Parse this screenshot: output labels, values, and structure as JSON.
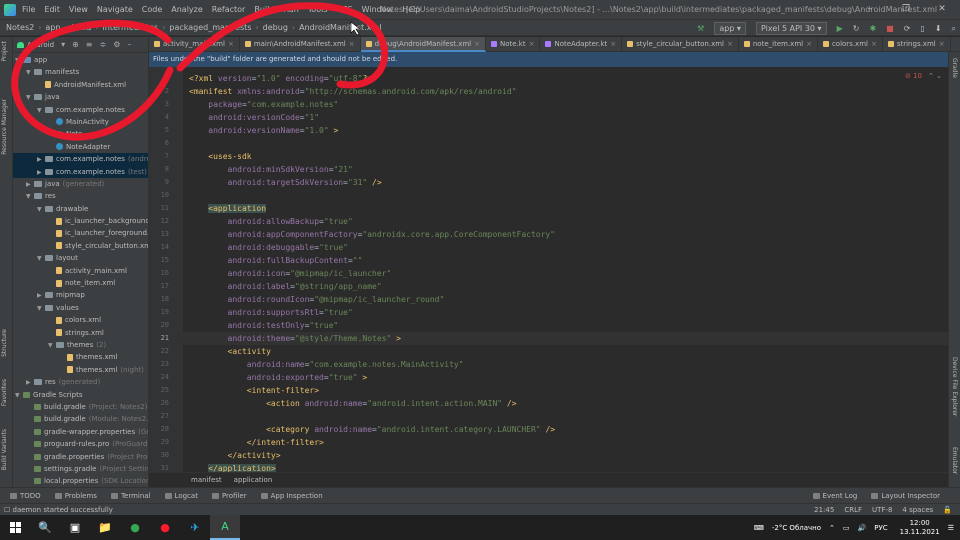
{
  "menubar": {
    "items": [
      "File",
      "Edit",
      "View",
      "Navigate",
      "Code",
      "Analyze",
      "Refactor",
      "Build",
      "Run",
      "Tools",
      "VCS",
      "Window",
      "Help"
    ],
    "window_title": "Notes [C:\\Users\\daima\\AndroidStudioProjects\\Notes2] - ...\\Notes2\\app\\build\\intermediates\\packaged_manifests\\debug\\AndroidManifest.xml",
    "controls": [
      "–",
      "❐",
      "✕"
    ]
  },
  "navbar": {
    "crumbs": [
      "Notes2",
      "app",
      "build",
      "intermediates",
      "packaged_manifests",
      "debug",
      "AndroidManifest.xml"
    ],
    "run_config": "app",
    "device": "Pixel 5 API 30"
  },
  "project_panel": {
    "title": "Android",
    "tree": [
      {
        "label": "app",
        "hint": "",
        "depth": 0,
        "arrow": "▼",
        "icon": "folder-blue"
      },
      {
        "label": "manifests",
        "hint": "",
        "depth": 1,
        "arrow": "▼",
        "icon": "folder"
      },
      {
        "label": "AndroidManifest.xml",
        "hint": "",
        "depth": 2,
        "arrow": "",
        "icon": "file-xml"
      },
      {
        "label": "java",
        "hint": "",
        "depth": 1,
        "arrow": "▼",
        "icon": "folder"
      },
      {
        "label": "com.example.notes",
        "hint": "",
        "depth": 2,
        "arrow": "▼",
        "icon": "folder"
      },
      {
        "label": "MainActivity",
        "hint": "",
        "depth": 3,
        "arrow": "",
        "icon": "file-c"
      },
      {
        "label": "Note",
        "hint": "",
        "depth": 3,
        "arrow": "",
        "icon": "file-c"
      },
      {
        "label": "NoteAdapter",
        "hint": "",
        "depth": 3,
        "arrow": "",
        "icon": "file-c"
      },
      {
        "label": "com.example.notes",
        "hint": "(androidTest)",
        "depth": 2,
        "arrow": "▶",
        "icon": "folder",
        "hl": true
      },
      {
        "label": "com.example.notes",
        "hint": "(test)",
        "depth": 2,
        "arrow": "▶",
        "icon": "folder",
        "hl": true
      },
      {
        "label": "java",
        "hint": "(generated)",
        "depth": 1,
        "arrow": "▶",
        "icon": "folder"
      },
      {
        "label": "res",
        "hint": "",
        "depth": 1,
        "arrow": "▼",
        "icon": "folder"
      },
      {
        "label": "drawable",
        "hint": "",
        "depth": 2,
        "arrow": "▼",
        "icon": "folder"
      },
      {
        "label": "ic_launcher_background.xml",
        "hint": "",
        "depth": 3,
        "arrow": "",
        "icon": "file-xml"
      },
      {
        "label": "ic_launcher_foreground.xml",
        "hint": "",
        "depth": 3,
        "arrow": "",
        "icon": "file-xml"
      },
      {
        "label": "style_circular_button.xml",
        "hint": "",
        "depth": 3,
        "arrow": "",
        "icon": "file-xml"
      },
      {
        "label": "layout",
        "hint": "",
        "depth": 2,
        "arrow": "▼",
        "icon": "folder"
      },
      {
        "label": "activity_main.xml",
        "hint": "",
        "depth": 3,
        "arrow": "",
        "icon": "file-xml"
      },
      {
        "label": "note_item.xml",
        "hint": "",
        "depth": 3,
        "arrow": "",
        "icon": "file-xml"
      },
      {
        "label": "mipmap",
        "hint": "",
        "depth": 2,
        "arrow": "▶",
        "icon": "folder"
      },
      {
        "label": "values",
        "hint": "",
        "depth": 2,
        "arrow": "▼",
        "icon": "folder"
      },
      {
        "label": "colors.xml",
        "hint": "",
        "depth": 3,
        "arrow": "",
        "icon": "file-xml"
      },
      {
        "label": "strings.xml",
        "hint": "",
        "depth": 3,
        "arrow": "",
        "icon": "file-xml"
      },
      {
        "label": "themes",
        "hint": "(2)",
        "depth": 3,
        "arrow": "▼",
        "icon": "folder"
      },
      {
        "label": "themes.xml",
        "hint": "",
        "depth": 4,
        "arrow": "",
        "icon": "file-xml"
      },
      {
        "label": "themes.xml",
        "hint": "(night)",
        "depth": 4,
        "arrow": "",
        "icon": "file-xml"
      },
      {
        "label": "res",
        "hint": "(generated)",
        "depth": 1,
        "arrow": "▶",
        "icon": "folder"
      },
      {
        "label": "Gradle Scripts",
        "hint": "",
        "depth": 0,
        "arrow": "▼",
        "icon": "file-gradle"
      },
      {
        "label": "build.gradle",
        "hint": "(Project: Notes2)",
        "depth": 1,
        "arrow": "",
        "icon": "file-gradle"
      },
      {
        "label": "build.gradle",
        "hint": "(Module: Notes2.app)",
        "depth": 1,
        "arrow": "",
        "icon": "file-gradle"
      },
      {
        "label": "gradle-wrapper.properties",
        "hint": "(Gradle Version)",
        "depth": 1,
        "arrow": "",
        "icon": "file-gradle"
      },
      {
        "label": "proguard-rules.pro",
        "hint": "(ProGuard Rules)",
        "depth": 1,
        "arrow": "",
        "icon": "file-gradle"
      },
      {
        "label": "gradle.properties",
        "hint": "(Project Properties)",
        "depth": 1,
        "arrow": "",
        "icon": "file-gradle"
      },
      {
        "label": "settings.gradle",
        "hint": "(Project Settings)",
        "depth": 1,
        "arrow": "",
        "icon": "file-gradle"
      },
      {
        "label": "local.properties",
        "hint": "(SDK Location)",
        "depth": 1,
        "arrow": "",
        "icon": "file-gradle"
      }
    ]
  },
  "left_strip": [
    "Project",
    "Resource Manager",
    "Structure",
    "Favorites",
    "Build Variants"
  ],
  "right_strip": [
    "Gradle",
    "Device File Explorer",
    "Emulator"
  ],
  "tabs": [
    {
      "label": "activity_main.xml",
      "active": false
    },
    {
      "label": "main\\AndroidManifest.xml",
      "active": false
    },
    {
      "label": "debug\\AndroidManifest.xml",
      "active": true
    },
    {
      "label": "Note.kt",
      "active": false
    },
    {
      "label": "NoteAdapter.kt",
      "active": false
    },
    {
      "label": "style_circular_button.xml",
      "active": false
    },
    {
      "label": "note_item.xml",
      "active": false
    },
    {
      "label": "colors.xml",
      "active": false
    },
    {
      "label": "strings.xml",
      "active": false
    }
  ],
  "banner": "Files under the \"build\" folder are generated and should not be edited.",
  "editor": {
    "error_count": "10",
    "current_line": 21,
    "lines": [
      {
        "n": "1",
        "indent": "",
        "parts": [
          [
            "decl",
            "<?xml "
          ],
          [
            "attr",
            "version"
          ],
          [
            "txt",
            "="
          ],
          [
            "str",
            "\"1.0\" "
          ],
          [
            "attr",
            "encoding"
          ],
          [
            "txt",
            "="
          ],
          [
            "str",
            "\"utf-8\""
          ],
          [
            "decl",
            "?>"
          ]
        ]
      },
      {
        "n": "2",
        "indent": "",
        "parts": [
          [
            "tag",
            "<manifest "
          ],
          [
            "ns",
            "xmlns:"
          ],
          [
            "attr",
            "android"
          ],
          [
            "txt",
            "="
          ],
          [
            "str",
            "\"http://schemas.android.com/apk/res/android\""
          ]
        ]
      },
      {
        "n": "3",
        "indent": "    ",
        "parts": [
          [
            "attr",
            "package"
          ],
          [
            "txt",
            "="
          ],
          [
            "str",
            "\"com.example.notes\""
          ]
        ]
      },
      {
        "n": "4",
        "indent": "    ",
        "parts": [
          [
            "ns",
            "android:"
          ],
          [
            "attr",
            "versionCode"
          ],
          [
            "txt",
            "="
          ],
          [
            "str",
            "\"1\""
          ]
        ]
      },
      {
        "n": "5",
        "indent": "    ",
        "parts": [
          [
            "ns",
            "android:"
          ],
          [
            "attr",
            "versionName"
          ],
          [
            "txt",
            "="
          ],
          [
            "str",
            "\"1.0\" "
          ],
          [
            "tag",
            ">"
          ]
        ]
      },
      {
        "n": "6",
        "indent": "",
        "parts": []
      },
      {
        "n": "7",
        "indent": "    ",
        "parts": [
          [
            "tag",
            "<uses-sdk"
          ]
        ]
      },
      {
        "n": "8",
        "indent": "        ",
        "parts": [
          [
            "ns",
            "android:"
          ],
          [
            "attr",
            "minSdkVersion"
          ],
          [
            "txt",
            "="
          ],
          [
            "str",
            "\"21\""
          ]
        ]
      },
      {
        "n": "9",
        "indent": "        ",
        "parts": [
          [
            "ns",
            "android:"
          ],
          [
            "attr",
            "targetSdkVersion"
          ],
          [
            "txt",
            "="
          ],
          [
            "str",
            "\"31\" "
          ],
          [
            "tag",
            "/>"
          ]
        ]
      },
      {
        "n": "10",
        "indent": "",
        "parts": []
      },
      {
        "n": "11",
        "indent": "    ",
        "parts": [
          [
            "tag",
            "<application"
          ]
        ]
      },
      {
        "n": "12",
        "indent": "        ",
        "parts": [
          [
            "ns",
            "android:"
          ],
          [
            "attr",
            "allowBackup"
          ],
          [
            "txt",
            "="
          ],
          [
            "str",
            "\"true\""
          ]
        ]
      },
      {
        "n": "13",
        "indent": "        ",
        "parts": [
          [
            "ns",
            "android:"
          ],
          [
            "attr",
            "appComponentFactory"
          ],
          [
            "txt",
            "="
          ],
          [
            "str",
            "\"androidx.core.app.CoreComponentFactory\""
          ]
        ]
      },
      {
        "n": "14",
        "indent": "        ",
        "parts": [
          [
            "ns",
            "android:"
          ],
          [
            "attr",
            "debuggable"
          ],
          [
            "txt",
            "="
          ],
          [
            "str",
            "\"true\""
          ]
        ]
      },
      {
        "n": "15",
        "indent": "        ",
        "parts": [
          [
            "ns",
            "android:"
          ],
          [
            "attr",
            "fullBackupContent"
          ],
          [
            "txt",
            "="
          ],
          [
            "str",
            "\"\""
          ]
        ]
      },
      {
        "n": "16",
        "indent": "        ",
        "parts": [
          [
            "ns",
            "android:"
          ],
          [
            "attr",
            "icon"
          ],
          [
            "txt",
            "="
          ],
          [
            "str",
            "\"@mipmap/ic_launcher\""
          ]
        ]
      },
      {
        "n": "17",
        "indent": "        ",
        "parts": [
          [
            "ns",
            "android:"
          ],
          [
            "attr",
            "label"
          ],
          [
            "txt",
            "="
          ],
          [
            "str",
            "\"@string/app_name\""
          ]
        ]
      },
      {
        "n": "18",
        "indent": "        ",
        "parts": [
          [
            "ns",
            "android:"
          ],
          [
            "attr",
            "roundIcon"
          ],
          [
            "txt",
            "="
          ],
          [
            "str",
            "\"@mipmap/ic_launcher_round\""
          ]
        ]
      },
      {
        "n": "19",
        "indent": "        ",
        "parts": [
          [
            "ns",
            "android:"
          ],
          [
            "attr",
            "supportsRtl"
          ],
          [
            "txt",
            "="
          ],
          [
            "str",
            "\"true\""
          ]
        ]
      },
      {
        "n": "20",
        "indent": "        ",
        "parts": [
          [
            "ns",
            "android:"
          ],
          [
            "attr",
            "testOnly"
          ],
          [
            "txt",
            "="
          ],
          [
            "str",
            "\"true\""
          ]
        ]
      },
      {
        "n": "21",
        "indent": "        ",
        "parts": [
          [
            "ns",
            "android:"
          ],
          [
            "attr",
            "theme"
          ],
          [
            "txt",
            "="
          ],
          [
            "str",
            "\"@style/Theme.Notes\" "
          ],
          [
            "tag",
            ">"
          ]
        ]
      },
      {
        "n": "22",
        "indent": "        ",
        "parts": [
          [
            "tag",
            "<activity"
          ]
        ]
      },
      {
        "n": "23",
        "indent": "            ",
        "parts": [
          [
            "ns",
            "android:"
          ],
          [
            "attr",
            "name"
          ],
          [
            "txt",
            "="
          ],
          [
            "str",
            "\"com.example.notes.MainActivity\""
          ]
        ]
      },
      {
        "n": "24",
        "indent": "            ",
        "parts": [
          [
            "ns",
            "android:"
          ],
          [
            "attr",
            "exported"
          ],
          [
            "txt",
            "="
          ],
          [
            "str",
            "\"true\" "
          ],
          [
            "tag",
            ">"
          ]
        ]
      },
      {
        "n": "25",
        "indent": "            ",
        "parts": [
          [
            "tag",
            "<intent-filter>"
          ]
        ]
      },
      {
        "n": "26",
        "indent": "                ",
        "parts": [
          [
            "tag",
            "<action "
          ],
          [
            "ns",
            "android:"
          ],
          [
            "attr",
            "name"
          ],
          [
            "txt",
            "="
          ],
          [
            "str",
            "\"android.intent.action.MAIN\" "
          ],
          [
            "tag",
            "/>"
          ]
        ]
      },
      {
        "n": "27",
        "indent": "",
        "parts": []
      },
      {
        "n": "28",
        "indent": "                ",
        "parts": [
          [
            "tag",
            "<category "
          ],
          [
            "ns",
            "android:"
          ],
          [
            "attr",
            "name"
          ],
          [
            "txt",
            "="
          ],
          [
            "str",
            "\"android.intent.category.LAUNCHER\" "
          ],
          [
            "tag",
            "/>"
          ]
        ]
      },
      {
        "n": "29",
        "indent": "            ",
        "parts": [
          [
            "tag",
            "</intent-filter>"
          ]
        ]
      },
      {
        "n": "30",
        "indent": "        ",
        "parts": [
          [
            "tag",
            "</activity>"
          ]
        ]
      },
      {
        "n": "31",
        "indent": "    ",
        "parts": [
          [
            "tag",
            "</application>"
          ]
        ]
      }
    ]
  },
  "editor_breadcrumb": [
    "manifest",
    "application"
  ],
  "bottom_tools": [
    "TODO",
    "Problems",
    "Terminal",
    "Logcat",
    "Profiler",
    "App Inspection"
  ],
  "bottom_tools_right": [
    "Event Log",
    "Layout Inspector"
  ],
  "status": {
    "message": "daemon started successfully",
    "position": "21:45",
    "line_sep": "CRLF",
    "encoding": "UTF-8",
    "indent": "4 spaces"
  },
  "taskbar": {
    "apps": [
      "🔍",
      "▣",
      "📁",
      "●",
      "●",
      "✈",
      "A"
    ],
    "weather": "-2°C  Облачно",
    "lang": "РУС",
    "time": "12:00",
    "date": "13.11.2021"
  },
  "colors": {
    "annotation": "#e8192c",
    "accent": "#4a88c7",
    "banner": "#2e4c6c"
  }
}
